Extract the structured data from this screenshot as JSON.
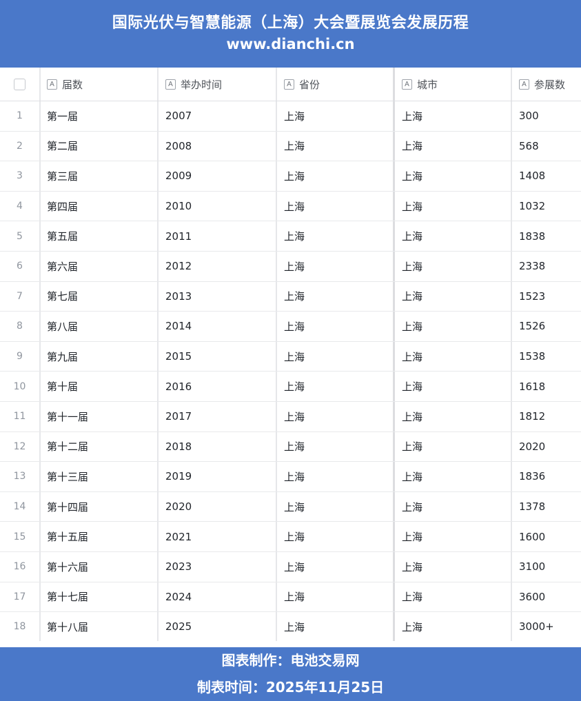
{
  "header": {
    "title": "国际光伏与智慧能源（上海）大会暨展览会发展历程",
    "url": "www.dianchi.cn"
  },
  "table": {
    "columns": [
      "届数",
      "举办时间",
      "省份",
      "城市",
      "参展数"
    ],
    "rows": [
      {
        "index": "1",
        "session": "第一届",
        "year": "2007",
        "province": "上海",
        "city": "上海",
        "exhibitors": "300"
      },
      {
        "index": "2",
        "session": "第二届",
        "year": "2008",
        "province": "上海",
        "city": "上海",
        "exhibitors": "568"
      },
      {
        "index": "3",
        "session": "第三届",
        "year": "2009",
        "province": "上海",
        "city": "上海",
        "exhibitors": "1408"
      },
      {
        "index": "4",
        "session": "第四届",
        "year": "2010",
        "province": "上海",
        "city": "上海",
        "exhibitors": "1032"
      },
      {
        "index": "5",
        "session": "第五届",
        "year": "2011",
        "province": "上海",
        "city": "上海",
        "exhibitors": "1838"
      },
      {
        "index": "6",
        "session": "第六届",
        "year": "2012",
        "province": "上海",
        "city": "上海",
        "exhibitors": "2338"
      },
      {
        "index": "7",
        "session": "第七届",
        "year": "2013",
        "province": "上海",
        "city": "上海",
        "exhibitors": "1523"
      },
      {
        "index": "8",
        "session": "第八届",
        "year": "2014",
        "province": "上海",
        "city": "上海",
        "exhibitors": "1526"
      },
      {
        "index": "9",
        "session": "第九届",
        "year": "2015",
        "province": "上海",
        "city": "上海",
        "exhibitors": "1538"
      },
      {
        "index": "10",
        "session": "第十届",
        "year": "2016",
        "province": "上海",
        "city": "上海",
        "exhibitors": "1618"
      },
      {
        "index": "11",
        "session": "第十一届",
        "year": "2017",
        "province": "上海",
        "city": "上海",
        "exhibitors": "1812"
      },
      {
        "index": "12",
        "session": "第十二届",
        "year": "2018",
        "province": "上海",
        "city": "上海",
        "exhibitors": "2020"
      },
      {
        "index": "13",
        "session": "第十三届",
        "year": "2019",
        "province": "上海",
        "city": "上海",
        "exhibitors": "1836"
      },
      {
        "index": "14",
        "session": "第十四届",
        "year": "2020",
        "province": "上海",
        "city": "上海",
        "exhibitors": "1378"
      },
      {
        "index": "15",
        "session": "第十五届",
        "year": "2021",
        "province": "上海",
        "city": "上海",
        "exhibitors": "1600"
      },
      {
        "index": "16",
        "session": "第十六届",
        "year": "2023",
        "province": "上海",
        "city": "上海",
        "exhibitors": "3100"
      },
      {
        "index": "17",
        "session": "第十七届",
        "year": "2024",
        "province": "上海",
        "city": "上海",
        "exhibitors": "3600"
      },
      {
        "index": "18",
        "session": "第十八届",
        "year": "2025",
        "province": "上海",
        "city": "上海",
        "exhibitors": "3000+"
      }
    ]
  },
  "footer": {
    "credit": "图表制作：电池交易网",
    "date": "制表时间：2025年11月25日"
  },
  "colors": {
    "banner": "#4a78c9",
    "grid_line": "#e6e7ea"
  },
  "icons": {
    "text_field": "text-field-icon"
  }
}
